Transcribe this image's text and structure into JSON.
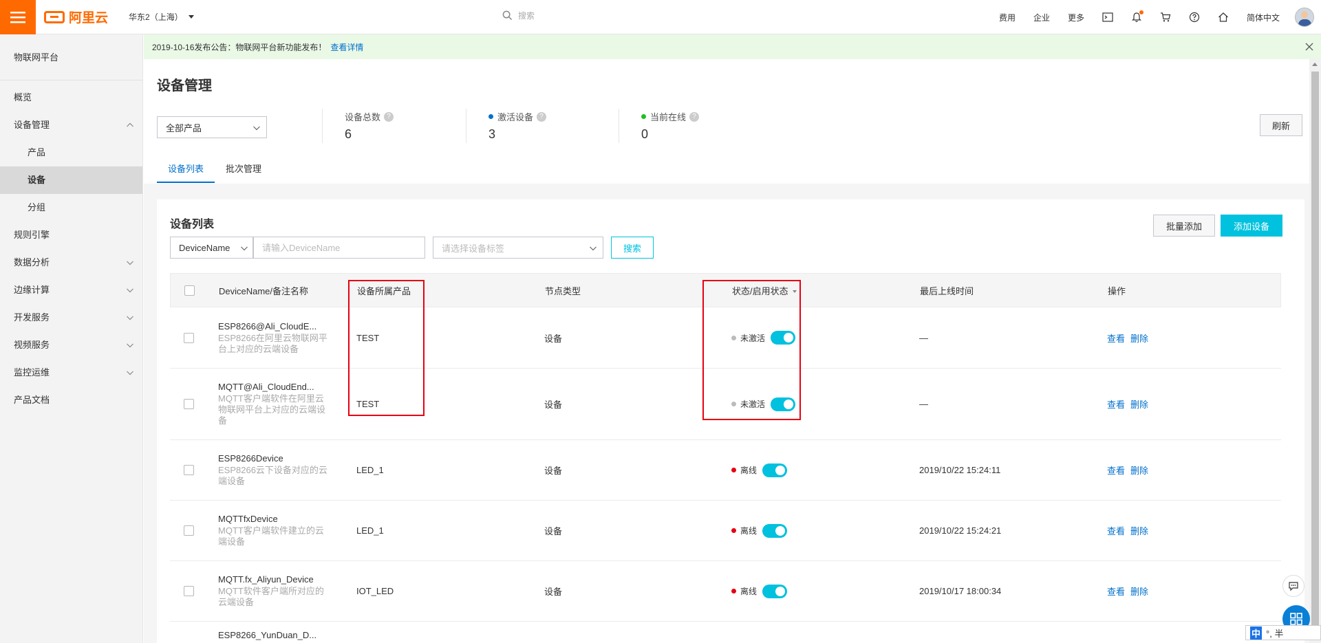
{
  "topbar": {
    "logo_text": "阿里云",
    "region": "华东2（上海）",
    "search_placeholder": "搜索",
    "links": [
      "费用",
      "企业",
      "更多"
    ],
    "language": "简体中文"
  },
  "sidebar": {
    "title": "物联网平台",
    "items": [
      {
        "label": "概览"
      },
      {
        "label": "设备管理"
      },
      {
        "label": "产品"
      },
      {
        "label": "设备"
      },
      {
        "label": "分组"
      },
      {
        "label": "规则引擎"
      },
      {
        "label": "数据分析"
      },
      {
        "label": "边缘计算"
      },
      {
        "label": "开发服务"
      },
      {
        "label": "视频服务"
      },
      {
        "label": "监控运维"
      },
      {
        "label": "产品文档"
      }
    ]
  },
  "notice": {
    "text": "2019-10-16发布公告：物联网平台新功能发布！",
    "link": "查看详情"
  },
  "page": {
    "title": "设备管理",
    "product_select": "全部产品",
    "refresh": "刷新",
    "stats": [
      {
        "label": "设备总数",
        "value": "6"
      },
      {
        "label": "激活设备",
        "value": "3",
        "dot_color": "#0070cc"
      },
      {
        "label": "当前在线",
        "value": "0",
        "dot_color": "#1dc11d"
      }
    ],
    "tabs": [
      "设备列表",
      "批次管理"
    ]
  },
  "card": {
    "title": "设备列表",
    "bulk_add": "批量添加",
    "add_device": "添加设备",
    "filter_field": "DeviceName",
    "filter_placeholder": "请输入DeviceName",
    "tag_placeholder": "请选择设备标签",
    "search": "搜索"
  },
  "table": {
    "headers": [
      "DeviceName/备注名称",
      "设备所属产品",
      "节点类型",
      "状态/启用状态",
      "最后上线时间",
      "操作"
    ],
    "rows": [
      {
        "name": "ESP8266@Ali_CloudE...",
        "note": "ESP8266在阿里云物联网平台上对应的云端设备",
        "product": "TEST",
        "node": "设备",
        "status": "未激活",
        "status_color": "#bbbbbb",
        "last_online": "—",
        "view": "查看",
        "delete": "删除"
      },
      {
        "name": "MQTT@Ali_CloudEnd...",
        "note": "MQTT客户端软件在阿里云物联网平台上对应的云端设备",
        "product": "TEST",
        "node": "设备",
        "status": "未激活",
        "status_color": "#bbbbbb",
        "last_online": "—",
        "view": "查看",
        "delete": "删除"
      },
      {
        "name": "ESP8266Device",
        "note": "ESP8266云下设备对应的云端设备",
        "product": "LED_1",
        "node": "设备",
        "status": "离线",
        "status_color": "#e60012",
        "last_online": "2019/10/22 15:24:11",
        "view": "查看",
        "delete": "删除"
      },
      {
        "name": "MQTTfxDevice",
        "note": "MQTT客户端软件建立的云端设备",
        "product": "LED_1",
        "node": "设备",
        "status": "离线",
        "status_color": "#e60012",
        "last_online": "2019/10/22 15:24:21",
        "view": "查看",
        "delete": "删除"
      },
      {
        "name": "MQTT.fx_Aliyun_Device",
        "note": "MQTT软件客户端所对应的云端设备",
        "product": "IOT_LED",
        "node": "设备",
        "status": "离线",
        "status_color": "#e60012",
        "last_online": "2019/10/17 18:00:34",
        "view": "查看",
        "delete": "删除"
      },
      {
        "name": "ESP8266_YunDuan_D...",
        "note": "",
        "product": "",
        "node": "",
        "status": "",
        "status_color": "",
        "last_online": "",
        "view": "",
        "delete": ""
      }
    ]
  },
  "ime": {
    "zh": "中",
    "rest": "°, 半"
  }
}
